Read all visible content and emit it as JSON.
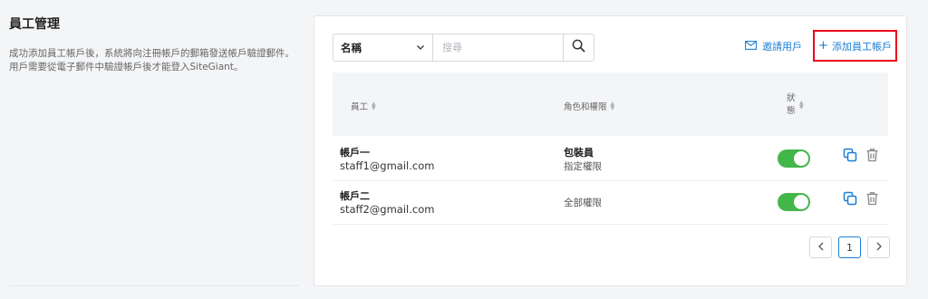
{
  "section": {
    "title": "員工管理",
    "description": "成功添加員工帳戶後，系統將向注冊帳戶的郵箱發送帳戶驗證郵件。用戶需要從電子郵件中驗證帳戶後才能登入SiteGiant。"
  },
  "search": {
    "filter_selected": "名稱",
    "placeholder": "搜尋"
  },
  "actions": {
    "invite_label": "邀請用戶",
    "add_staff_label": "添加員工帳戶"
  },
  "table": {
    "columns": {
      "staff": "員工",
      "role": "角色和權限",
      "status": "狀態"
    },
    "rows": [
      {
        "name": "帳戶一",
        "email": "staff1@gmail.com",
        "role": "包裝員",
        "permission": "指定權限",
        "enabled": true
      },
      {
        "name": "帳戶二",
        "email": "staff2@gmail.com",
        "role": "",
        "permission": "全部權限",
        "enabled": true
      }
    ]
  },
  "pagination": {
    "current_page": "1",
    "prev_icon": "chevron-left-icon",
    "next_icon": "chevron-right-icon"
  },
  "colors": {
    "link": "#1b7fd6",
    "toggle_on": "#43b649",
    "highlight_border": "#e8001c"
  }
}
